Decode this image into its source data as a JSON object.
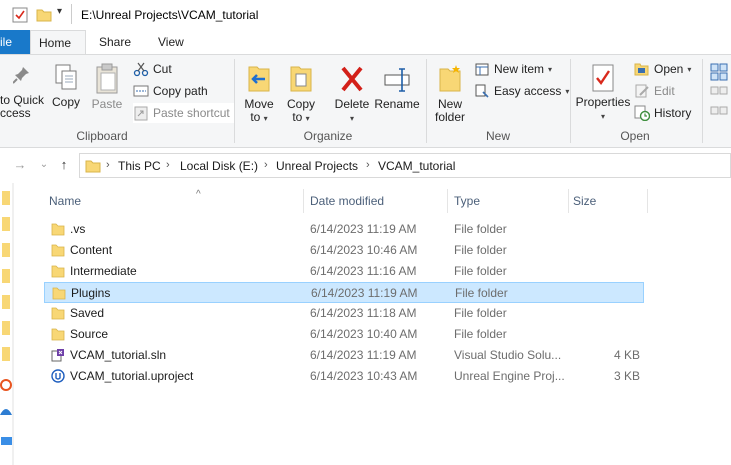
{
  "window": {
    "title": "E:\\Unreal Projects\\VCAM_tutorial"
  },
  "tabs": {
    "file": "ile",
    "home": "Home",
    "share": "Share",
    "view": "View"
  },
  "ribbon": {
    "clipboard": {
      "pin_to_quick_access_line1": "to Quick",
      "pin_to_quick_access_line2": "ccess",
      "copy": "Copy",
      "paste": "Paste",
      "cut": "Cut",
      "copy_path": "Copy path",
      "paste_shortcut": "Paste shortcut",
      "group_label": "Clipboard"
    },
    "organize": {
      "move_to_line1": "Move",
      "move_to_line2": "to",
      "copy_to_line1": "Copy",
      "copy_to_line2": "to",
      "delete": "Delete",
      "rename": "Rename",
      "group_label": "Organize"
    },
    "new": {
      "new_folder_line1": "New",
      "new_folder_line2": "folder",
      "new_item": "New item",
      "easy_access": "Easy access",
      "group_label": "New"
    },
    "open": {
      "properties": "Properties",
      "open": "Open",
      "edit": "Edit",
      "history": "History",
      "group_label": "Open"
    }
  },
  "address": {
    "crumbs": [
      "This PC",
      "Local Disk (E:)",
      "Unreal Projects",
      "VCAM_tutorial"
    ]
  },
  "columns": {
    "name": "Name",
    "date": "Date modified",
    "type": "Type",
    "size": "Size"
  },
  "files": [
    {
      "name": ".vs",
      "date": "6/14/2023 11:19 AM",
      "type": "File folder",
      "size": "",
      "icon": "folder-icon"
    },
    {
      "name": "Content",
      "date": "6/14/2023 10:46 AM",
      "type": "File folder",
      "size": "",
      "icon": "folder-icon"
    },
    {
      "name": "Intermediate",
      "date": "6/14/2023 11:16 AM",
      "type": "File folder",
      "size": "",
      "icon": "folder-icon"
    },
    {
      "name": "Plugins",
      "date": "6/14/2023 11:19 AM",
      "type": "File folder",
      "size": "",
      "icon": "folder-icon",
      "selected": true
    },
    {
      "name": "Saved",
      "date": "6/14/2023 11:18 AM",
      "type": "File folder",
      "size": "",
      "icon": "folder-icon"
    },
    {
      "name": "Source",
      "date": "6/14/2023 10:40 AM",
      "type": "File folder",
      "size": "",
      "icon": "folder-icon"
    },
    {
      "name": "VCAM_tutorial.sln",
      "date": "6/14/2023 11:19 AM",
      "type": "Visual Studio Solu...",
      "size": "4 KB",
      "icon": "visual-studio-solution-icon"
    },
    {
      "name": "VCAM_tutorial.uproject",
      "date": "6/14/2023 10:43 AM",
      "type": "Unreal Engine Proj...",
      "size": "3 KB",
      "icon": "unreal-engine-icon"
    }
  ],
  "colors": {
    "accent": "#1979ca",
    "selection": "#cce8ff",
    "selection_border": "#99d1ff",
    "folder": "#f8d775"
  }
}
